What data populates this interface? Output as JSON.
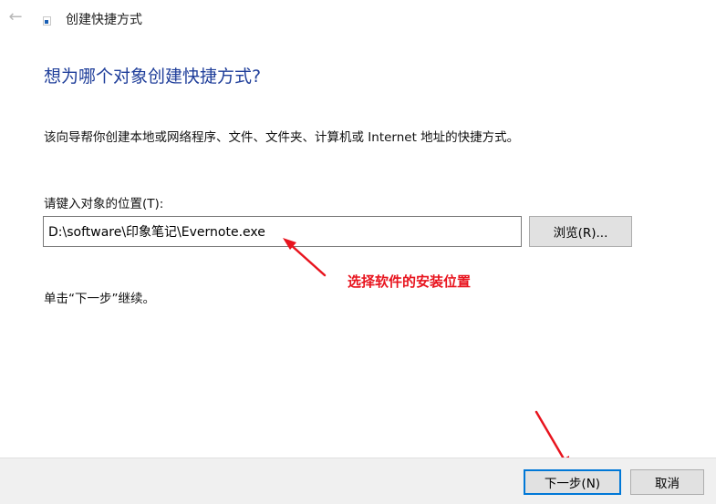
{
  "window": {
    "title": "创建快捷方式",
    "back_glyph": "←"
  },
  "main": {
    "heading": "想为哪个对象创建快捷方式?",
    "description": "该向导帮你创建本地或网络程序、文件、文件夹、计算机或 Internet 地址的快捷方式。",
    "location_label": "请键入对象的位置(T):",
    "location_value": "D:\\software\\印象笔记\\Evernote.exe",
    "browse_label": "浏览(R)...",
    "continue_hint": "单击“下一步”继续。"
  },
  "annotation": {
    "text": "选择软件的安装位置",
    "color": "#e8141e"
  },
  "footer": {
    "next_label": "下一步(N)",
    "cancel_label": "取消"
  },
  "colors": {
    "heading": "#1f3e9a",
    "focus_border": "#0078d7",
    "footer_bg": "#f0f0f0",
    "button_bg": "#e1e1e1"
  },
  "icons": {
    "back": "back-arrow-icon",
    "app": "shortcut-app-icon"
  }
}
